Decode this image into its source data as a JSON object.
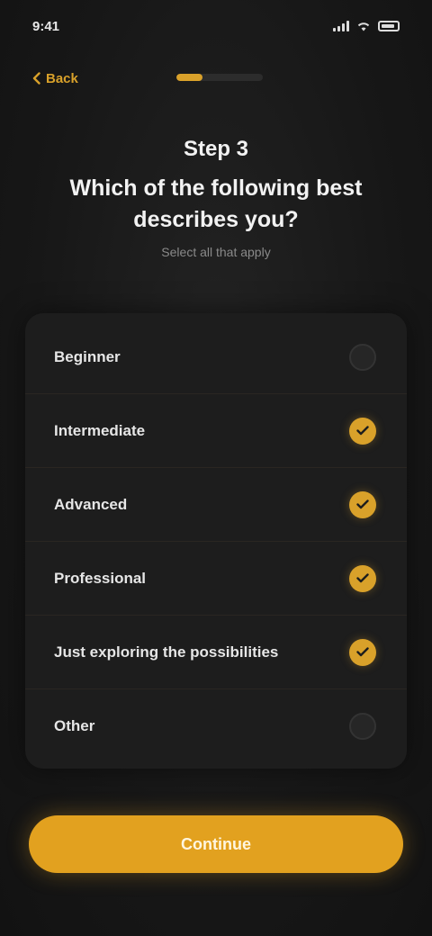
{
  "status_bar": {
    "time": "9:41"
  },
  "nav": {
    "back_label": "Back",
    "progress": 0.3
  },
  "header": {
    "title": "Step 3",
    "question": "Which of the following best describes you?",
    "subtitle": "Select all that apply"
  },
  "options": [
    {
      "label": "Beginner",
      "checked": false
    },
    {
      "label": "Intermediate",
      "checked": true
    },
    {
      "label": "Advanced",
      "checked": true
    },
    {
      "label": "Professional",
      "checked": true
    },
    {
      "label": "Just exploring the possibilities",
      "checked": true
    },
    {
      "label": "Other",
      "checked": false
    }
  ],
  "colors": {
    "accent": "#d9a12a",
    "background": "#141414",
    "card": "#1d1d1d"
  },
  "continue_label": "Continue"
}
